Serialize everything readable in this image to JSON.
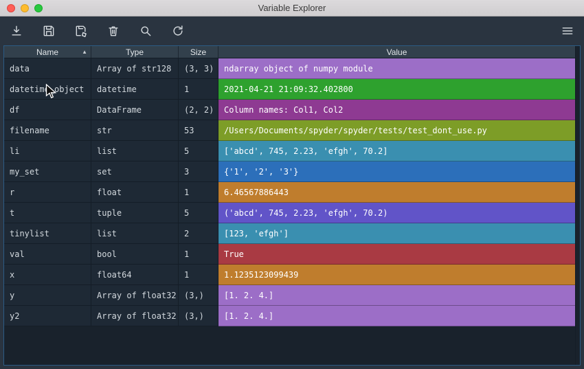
{
  "window": {
    "title": "Variable Explorer"
  },
  "toolbar": {
    "icons": [
      "import-data-icon",
      "save-data-icon",
      "save-data-as-icon",
      "remove-variables-icon",
      "search-icon",
      "refresh-icon",
      "options-menu-icon"
    ]
  },
  "table": {
    "headers": {
      "name": "Name",
      "type": "Type",
      "size": "Size",
      "value": "Value"
    },
    "sort_indicator": "▲",
    "rows": [
      {
        "name": "data",
        "type": "Array of str128",
        "size": "(3, 3)",
        "value": "ndarray object of numpy module",
        "color": "#9c6ec7"
      },
      {
        "name": "datetime_object",
        "type": "datetime",
        "size": "1",
        "value": "2021-04-21 21:09:32.402800",
        "color": "#2ea12e"
      },
      {
        "name": "df",
        "type": "DataFrame",
        "size": "(2, 2)",
        "value": "Column names: Col1, Col2",
        "color": "#8e3a92"
      },
      {
        "name": "filename",
        "type": "str",
        "size": "53",
        "value": "/Users/Documents/spyder/spyder/tests/test_dont_use.py",
        "color": "#7d9d27"
      },
      {
        "name": "li",
        "type": "list",
        "size": "5",
        "value": "['abcd', 745, 2.23, 'efgh', 70.2]",
        "color": "#3a8fb0"
      },
      {
        "name": "my_set",
        "type": "set",
        "size": "3",
        "value": "{'1', '2', '3'}",
        "color": "#2c6fba"
      },
      {
        "name": "r",
        "type": "float",
        "size": "1",
        "value": "6.46567886443",
        "color": "#bf7d2d"
      },
      {
        "name": "t",
        "type": "tuple",
        "size": "5",
        "value": "('abcd', 745, 2.23, 'efgh', 70.2)",
        "color": "#6154c8"
      },
      {
        "name": "tinylist",
        "type": "list",
        "size": "2",
        "value": "[123, 'efgh']",
        "color": "#3a8fb0"
      },
      {
        "name": "val",
        "type": "bool",
        "size": "1",
        "value": "True",
        "color": "#a93a43"
      },
      {
        "name": "x",
        "type": "float64",
        "size": "1",
        "value": "1.1235123099439",
        "color": "#bf7d2d"
      },
      {
        "name": "y",
        "type": "Array of float32",
        "size": "(3,)",
        "value": "[1. 2. 4.]",
        "color": "#9c6ec7"
      },
      {
        "name": "y2",
        "type": "Array of float32",
        "size": "(3,)",
        "value": "[1. 2. 4.]",
        "color": "#9c6ec7"
      }
    ]
  }
}
